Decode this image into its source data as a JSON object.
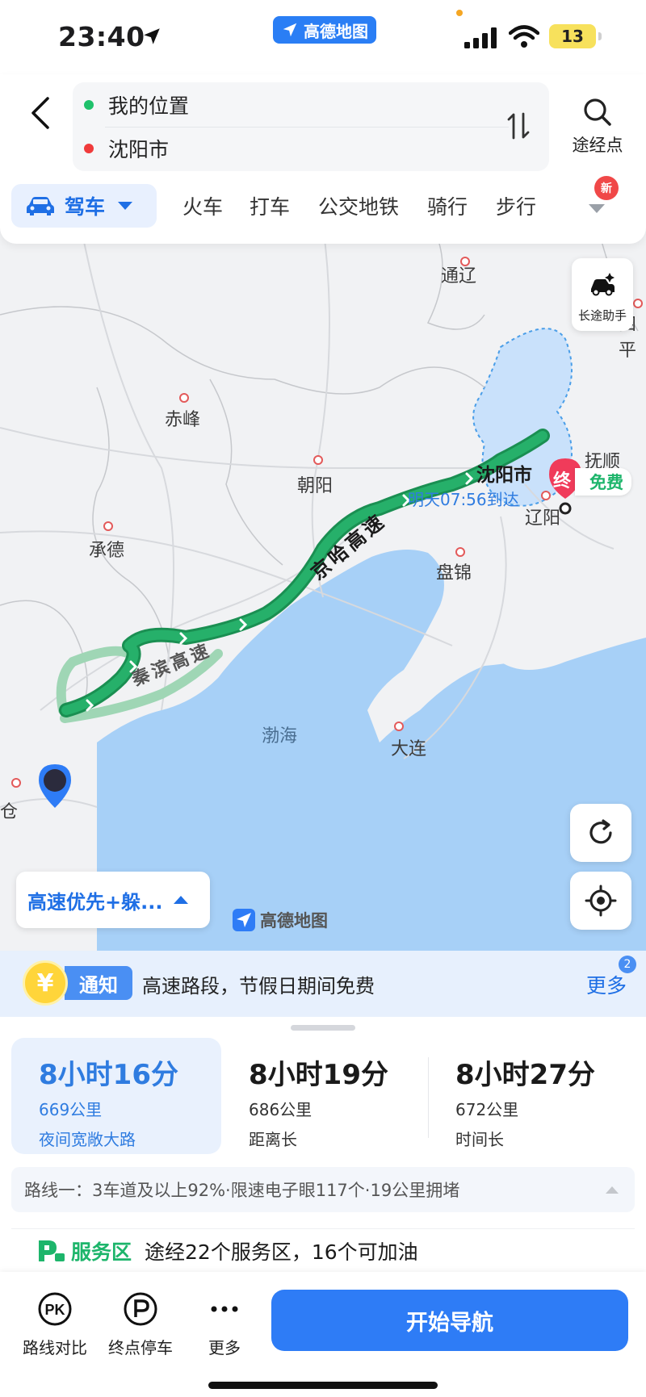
{
  "status_bar": {
    "time": "23:40",
    "app_badge": "高德地图",
    "battery": "13",
    "icons": [
      "location-arrow-icon",
      "signal-icon",
      "wifi-icon",
      "battery-icon"
    ]
  },
  "header": {
    "start": "我的位置",
    "destination": "沈阳市",
    "waypoint_label": "途经点"
  },
  "modes": {
    "active": "驾车",
    "tabs": [
      "火车",
      "打车",
      "公交地铁",
      "骑行",
      "步行"
    ],
    "new_badge": "新"
  },
  "map": {
    "cities": [
      {
        "name": "通辽"
      },
      {
        "name": "赤峰"
      },
      {
        "name": "朝阳"
      },
      {
        "name": "承德"
      },
      {
        "name": "辽阳"
      },
      {
        "name": "盘锦"
      },
      {
        "name": "大连"
      },
      {
        "name": "抚顺"
      },
      {
        "name": "四平"
      },
      {
        "name": "仓"
      }
    ],
    "sea_label": "渤海",
    "road_main": "京哈高速",
    "road_alt": "秦滨高速",
    "destination_label": "沈阳市",
    "arrival": "明天07:56到达",
    "end_marker": "终",
    "free_tag": "免费",
    "longtrip_label": "长途助手",
    "route_pref": "高速优先+躲...",
    "map_logo": "高德地图"
  },
  "notice": {
    "coin_symbol": "¥",
    "tag": "通知",
    "text": "高速路段，节假日期间免费",
    "more": "更多",
    "count": "2"
  },
  "routes": [
    {
      "duration": "8小时16分",
      "distance": "669公里",
      "tag": "夜间宽敞大路",
      "selected": true
    },
    {
      "duration": "8小时19分",
      "distance": "686公里",
      "tag": "距离长",
      "selected": false
    },
    {
      "duration": "8小时27分",
      "distance": "672公里",
      "tag": "时间长",
      "selected": false
    }
  ],
  "route_detail": "路线一：3车道及以上92%·限速电子眼117个·19公里拥堵",
  "service_area": {
    "label": "服务区",
    "text": "途经22个服务区，16个可加油"
  },
  "bottom_bar": {
    "compare": "路线对比",
    "compare_icon_text": "PK",
    "parking": "终点停车",
    "more": "更多",
    "start_nav": "开始导航"
  },
  "colors": {
    "accent": "#2e7cf6",
    "route_green": "#1fa863",
    "sea": "#a7d0f7",
    "destination_red": "#f03b5a"
  }
}
